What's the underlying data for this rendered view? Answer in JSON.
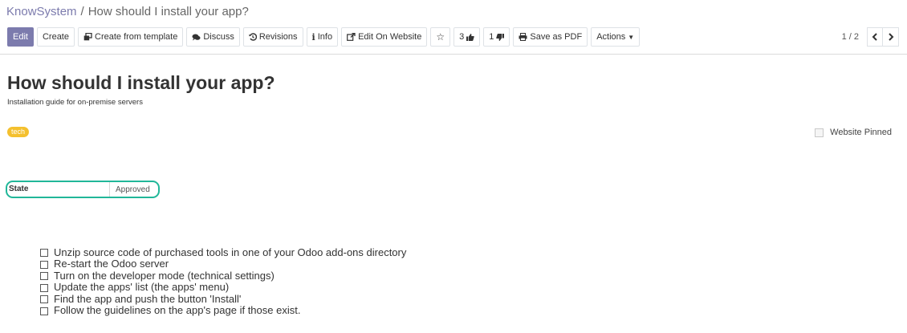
{
  "breadcrumb": {
    "parent": "KnowSystem",
    "separator": "/",
    "current": "How should I install your app?"
  },
  "toolbar": {
    "edit": "Edit",
    "create": "Create",
    "create_from_template": "Create from template",
    "discuss": "Discuss",
    "revisions": "Revisions",
    "info": "Info",
    "edit_on_website": "Edit On Website",
    "likes": "3",
    "dislikes": "1",
    "save_as_pdf": "Save as PDF",
    "actions": "Actions"
  },
  "pager": {
    "text": "1 / 2"
  },
  "article": {
    "title": "How should I install your app?",
    "subtitle": "Installation guide for on-premise servers",
    "tag": "tech",
    "website_pinned_label": "Website Pinned",
    "state_label": "State",
    "state_value": "Approved",
    "checklist": [
      "Unzip source code of purchased tools in one of your Odoo add-ons directory",
      "Re-start the Odoo server",
      "Turn on the developer mode (technical settings)",
      "Update the apps' list (the apps' menu)",
      "Find the app and push the button 'Install'",
      "Follow the guidelines on the app's page if those exist."
    ]
  },
  "colors": {
    "primary": "#7c7bad",
    "tag": "#f4c02e",
    "state_highlight": "#21b799"
  }
}
